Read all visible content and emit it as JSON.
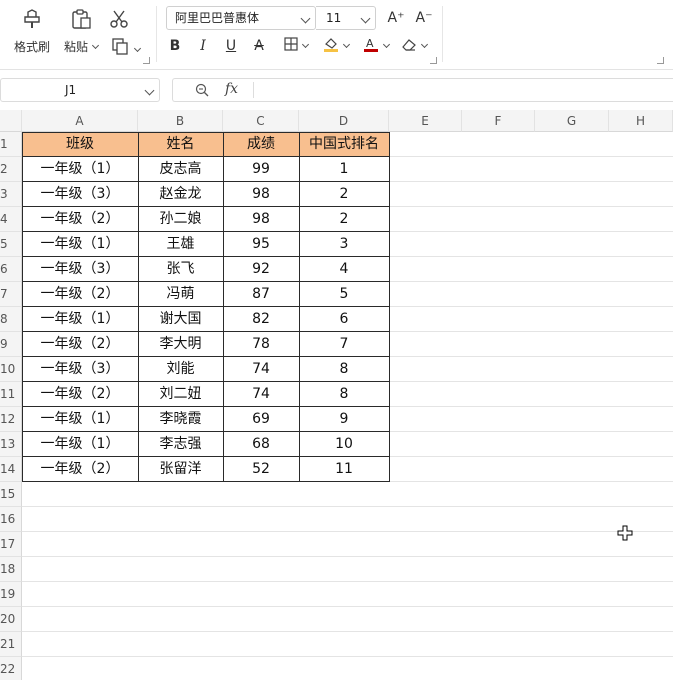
{
  "toolbar": {
    "format_painter_label": "格式刷",
    "paste_label": "粘贴",
    "font_name": "阿里巴巴普惠体",
    "font_size": "11",
    "increase_font": "A⁺",
    "decrease_font": "A⁻",
    "bold": "B",
    "italic": "I",
    "underline": "U",
    "strikethrough": "A",
    "highlight_color": "#f6c244",
    "font_color": "#c00000"
  },
  "formula_bar": {
    "name_box": "J1",
    "fx_label": "fx",
    "formula": ""
  },
  "columns": [
    "A",
    "B",
    "C",
    "D",
    "E",
    "F",
    "G",
    "H"
  ],
  "rows": [
    "1",
    "2",
    "3",
    "4",
    "5",
    "6",
    "7",
    "8",
    "9",
    "10",
    "11",
    "12",
    "13",
    "14",
    "15",
    "16",
    "17",
    "18",
    "19",
    "20",
    "21",
    "22"
  ],
  "table": {
    "header_fill": "#f8bf8f",
    "headers": [
      "班级",
      "姓名",
      "成绩",
      "中国式排名"
    ],
    "records": [
      [
        "一年级（1）",
        "皮志高",
        "99",
        "1"
      ],
      [
        "一年级（3）",
        "赵金龙",
        "98",
        "2"
      ],
      [
        "一年级（2）",
        "孙二娘",
        "98",
        "2"
      ],
      [
        "一年级（1）",
        "王雄",
        "95",
        "3"
      ],
      [
        "一年级（3）",
        "张飞",
        "92",
        "4"
      ],
      [
        "一年级（2）",
        "冯萌",
        "87",
        "5"
      ],
      [
        "一年级（1）",
        "谢大国",
        "82",
        "6"
      ],
      [
        "一年级（2）",
        "李大明",
        "78",
        "7"
      ],
      [
        "一年级（3）",
        "刘能",
        "74",
        "8"
      ],
      [
        "一年级（2）",
        "刘二妞",
        "74",
        "8"
      ],
      [
        "一年级（1）",
        "李晓霞",
        "69",
        "9"
      ],
      [
        "一年级（1）",
        "李志强",
        "68",
        "10"
      ],
      [
        "一年级（2）",
        "张留洋",
        "52",
        "11"
      ]
    ]
  }
}
